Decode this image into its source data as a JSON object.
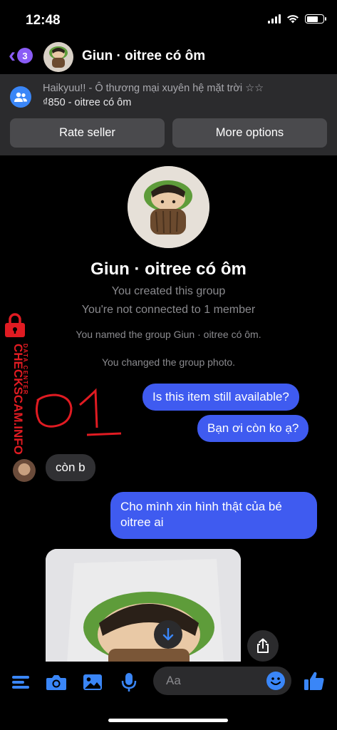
{
  "status_bar": {
    "time": "12:48"
  },
  "header": {
    "back_badge_count": "3",
    "title": "Giun · oitree có ôm"
  },
  "listing": {
    "title": "Haikyuu!! - Ô thương mại xuyên hệ mặt trời ☆☆",
    "price_line": "₫850 - oitree có ôm",
    "rate_button": "Rate seller",
    "more_button": "More options"
  },
  "profile": {
    "group_name": "Giun · oitree có ôm",
    "created_text": "You created this group",
    "connected_text": "You're not connected to 1 member"
  },
  "system_messages": {
    "named_group": "You named the group Giun · oitree có ôm.",
    "changed_photo": "You changed the group photo."
  },
  "messages": [
    {
      "text": "Is this item still available?",
      "direction": "outgoing"
    },
    {
      "text": "Bạn ơi còn ko ạ?",
      "direction": "outgoing"
    },
    {
      "text": "còn b",
      "direction": "incoming"
    },
    {
      "text_line1": "Cho mình xin hình thật của bé",
      "text_line2": "oitree ai",
      "direction": "outgoing"
    }
  ],
  "watermark": {
    "brand": "CHECKSCAM.INFO",
    "tag": "DATA CENTER",
    "annotation": "01"
  },
  "composer": {
    "placeholder": "Aa"
  },
  "colors": {
    "accent_purple": "#8a5cf6",
    "outgoing_bubble": "#3f5bf0",
    "icon_blue": "#3a86f7",
    "watermark_red": "#e01b22"
  },
  "icons": [
    "back-chevron-icon",
    "group-icon",
    "menu-icon",
    "camera-icon",
    "image-icon",
    "microphone-icon",
    "emoji-icon",
    "thumbs-up-icon",
    "share-icon",
    "arrow-down-icon"
  ]
}
